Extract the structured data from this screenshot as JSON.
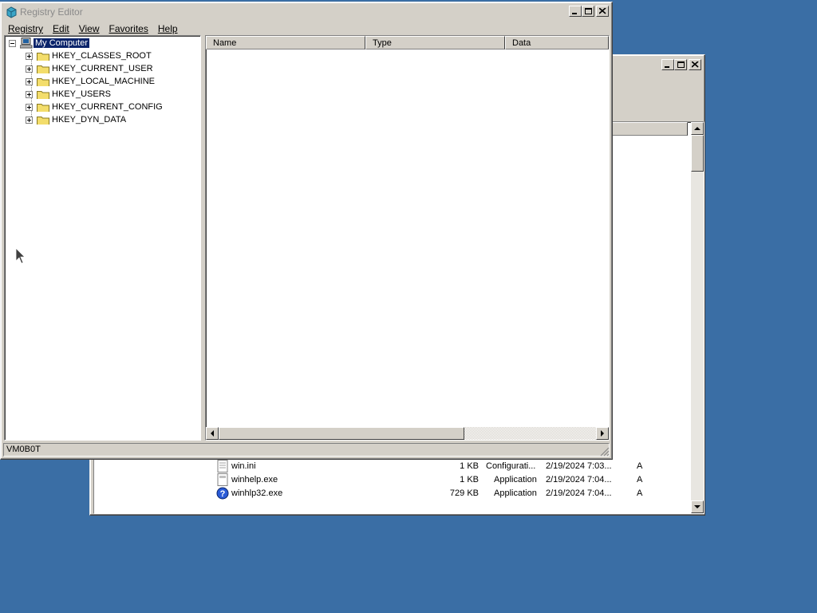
{
  "registry_editor": {
    "title": "Registry Editor",
    "menu": [
      {
        "label": "Registry",
        "accel": "R"
      },
      {
        "label": "Edit",
        "accel": "E"
      },
      {
        "label": "View",
        "accel": "V"
      },
      {
        "label": "Favorites",
        "accel": "a"
      },
      {
        "label": "Help",
        "accel": "H"
      }
    ],
    "tree": {
      "root": "My Computer",
      "items": [
        "HKEY_CLASSES_ROOT",
        "HKEY_CURRENT_USER",
        "HKEY_LOCAL_MACHINE",
        "HKEY_USERS",
        "HKEY_CURRENT_CONFIG",
        "HKEY_DYN_DATA"
      ]
    },
    "columns": [
      "Name",
      "Type",
      "Data"
    ],
    "status": "VM0B0T"
  },
  "explorer": {
    "files": [
      {
        "name": "win.ini",
        "size": "1 KB",
        "type": "Configurati...",
        "modified": "2/19/2024 7:03...",
        "attr": "A",
        "icon": "ini-file-icon"
      },
      {
        "name": "winhelp.exe",
        "size": "1 KB",
        "type": "Application",
        "modified": "2/19/2024 7:04...",
        "attr": "A",
        "icon": "exe-file-icon"
      },
      {
        "name": "winhlp32.exe",
        "size": "729 KB",
        "type": "Application",
        "modified": "2/19/2024 7:04...",
        "attr": "A",
        "icon": "help-icon"
      }
    ]
  },
  "colors": {
    "desktop": "#3a6ea5",
    "selection": "#0a246a",
    "window": "#d4d0c8"
  }
}
